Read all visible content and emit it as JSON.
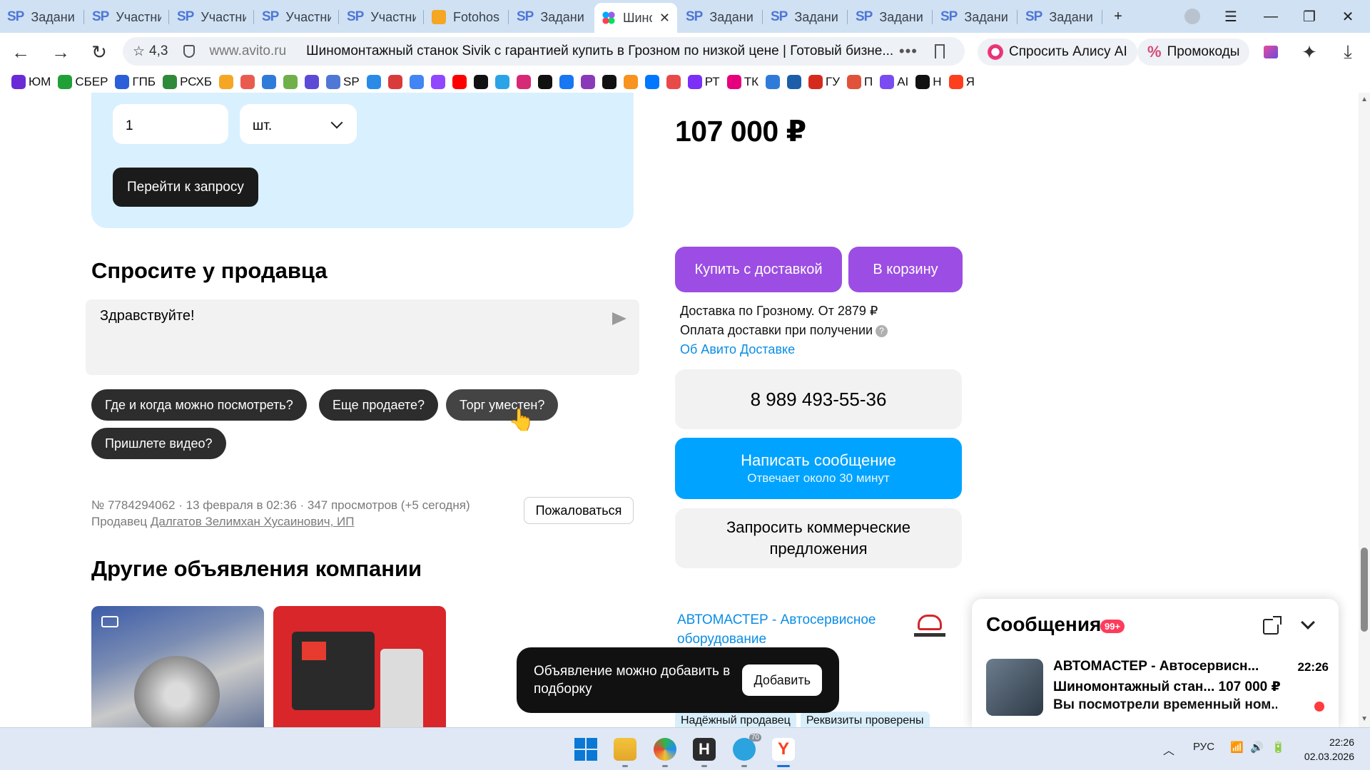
{
  "browser": {
    "tabs": [
      {
        "kind": "sp",
        "title": "Задани"
      },
      {
        "kind": "sp",
        "title": "Участни"
      },
      {
        "kind": "sp",
        "title": "Участни"
      },
      {
        "kind": "sp",
        "title": "Участни"
      },
      {
        "kind": "sp",
        "title": "Участни"
      },
      {
        "kind": "fotohost",
        "title": "Fotohos"
      },
      {
        "kind": "sp",
        "title": "Задани"
      },
      {
        "kind": "avito",
        "title": "Шино",
        "active": true
      },
      {
        "kind": "sp",
        "title": "Задани"
      },
      {
        "kind": "sp",
        "title": "Задани"
      },
      {
        "kind": "sp",
        "title": "Задани"
      },
      {
        "kind": "sp",
        "title": "Задани"
      },
      {
        "kind": "sp",
        "title": "Задани"
      }
    ],
    "sp_label": "SP",
    "new_tab_symbol": "+",
    "rating": "4,3",
    "domain": "www.avito.ru",
    "page_title": "Шиномонтажный станок Sivik с гарантией купить в Грозном по низкой цене | Готовый бизне...",
    "url_dots": "•••",
    "alice_label": "Спросить Алису AI",
    "promo_label": "Промокоды",
    "bookmarks": [
      {
        "label": "ЮМ",
        "color": "#6a2bd6"
      },
      {
        "label": "СБЕР",
        "color": "#21a038"
      },
      {
        "label": "ГПБ",
        "color": "#2b5fd9"
      },
      {
        "label": "РСХБ",
        "color": "#2f8a3a"
      },
      {
        "label": "",
        "color": "#f5a623"
      },
      {
        "label": "",
        "color": "#e95b4f"
      },
      {
        "label": "",
        "color": "#2f7bd9"
      },
      {
        "label": "",
        "color": "#6fb04a"
      },
      {
        "label": "",
        "color": "#5b4bd6"
      },
      {
        "label": "SP",
        "color": "#4f77d6"
      },
      {
        "label": "",
        "color": "#2a8ae6"
      },
      {
        "label": "",
        "color": "#d93a3a"
      },
      {
        "label": "",
        "color": "#4285f4"
      },
      {
        "label": "",
        "color": "#9146ff"
      },
      {
        "label": "",
        "color": "#ff0000"
      },
      {
        "label": "",
        "color": "#111111"
      },
      {
        "label": "",
        "color": "#2aa4e6"
      },
      {
        "label": "",
        "color": "#d62976"
      },
      {
        "label": "",
        "color": "#111111"
      },
      {
        "label": "",
        "color": "#1877f2"
      },
      {
        "label": "",
        "color": "#8a3ab9"
      },
      {
        "label": "",
        "color": "#111111"
      },
      {
        "label": "",
        "color": "#f7931e"
      },
      {
        "label": "",
        "color": "#0077ff"
      },
      {
        "label": "",
        "color": "#e84a4a"
      },
      {
        "label": "РТ",
        "color": "#7b2ff7"
      },
      {
        "label": "ТК",
        "color": "#e6007e"
      },
      {
        "label": "",
        "color": "#2f7bd9"
      },
      {
        "label": "",
        "color": "#1c5fa8"
      },
      {
        "label": "ГУ",
        "color": "#d52b1e"
      },
      {
        "label": "П",
        "color": "#e0523a"
      },
      {
        "label": "AI",
        "color": "#7b4bf2"
      },
      {
        "label": "Н",
        "color": "#111111"
      },
      {
        "label": "Я",
        "color": "#fc3f1d"
      }
    ]
  },
  "request": {
    "quantity": "1",
    "unit": "шт.",
    "go_label": "Перейти к запросу"
  },
  "price": "107 000 ₽",
  "ask": {
    "title": "Спросите у продавца",
    "message": "Здравствуйте!",
    "chips": [
      "Где и когда можно посмотреть?",
      "Еще продаете?",
      "Торг уместен?",
      "Пришлете видео?"
    ]
  },
  "meta": {
    "line1": "№ 7784294062 · 13 февраля в 02:36 · 347 просмотров (+5 сегодня)",
    "seller_prefix": "Продавец ",
    "seller_link": "Далгатов Зелимхан Хусаинович, ИП",
    "complain": "Пожаловаться"
  },
  "other_title": "Другие объявления компании",
  "buy": {
    "delivery_label": "Купить с доставкой",
    "cart_label": "В корзину",
    "delivery_line1": "Доставка по Грозному. От 2879 ₽",
    "delivery_line2": "Оплата доставки при получении",
    "help_glyph": "?",
    "delivery_link": "Об Авито Доставке"
  },
  "contact": {
    "phone": "8 989 493-55-36",
    "write_label": "Написать сообщение",
    "write_sub": "Отвечает около 30 минут",
    "cp_label": "Запросить коммерческие предложения"
  },
  "seller": {
    "name": "АВТОМАСТЕР - Автосервисное оборудование",
    "badges": [
      "Надёжный продавец",
      "Реквизиты проверены"
    ]
  },
  "toast": {
    "text": "Объявление можно добавить в подборку",
    "add_label": "Добавить"
  },
  "messages": {
    "title": "Сообщения",
    "count": "99+",
    "item": {
      "name": "АВТОМАСТЕР - Автосервисн...",
      "line2": "Шиномонтажный стан... 107 000 ₽",
      "line3": "Вы посмотрели временный ном...",
      "time": "22:26"
    }
  },
  "taskbar": {
    "lang": "РУС",
    "time": "22:26",
    "date": "02.03.2026",
    "telegram_badge": "70"
  },
  "colors": {
    "accent_purple": "#9c4de3",
    "accent_blue": "#00a3ff",
    "panel_blue": "#d9f0ff",
    "link_blue": "#0a8de6"
  }
}
